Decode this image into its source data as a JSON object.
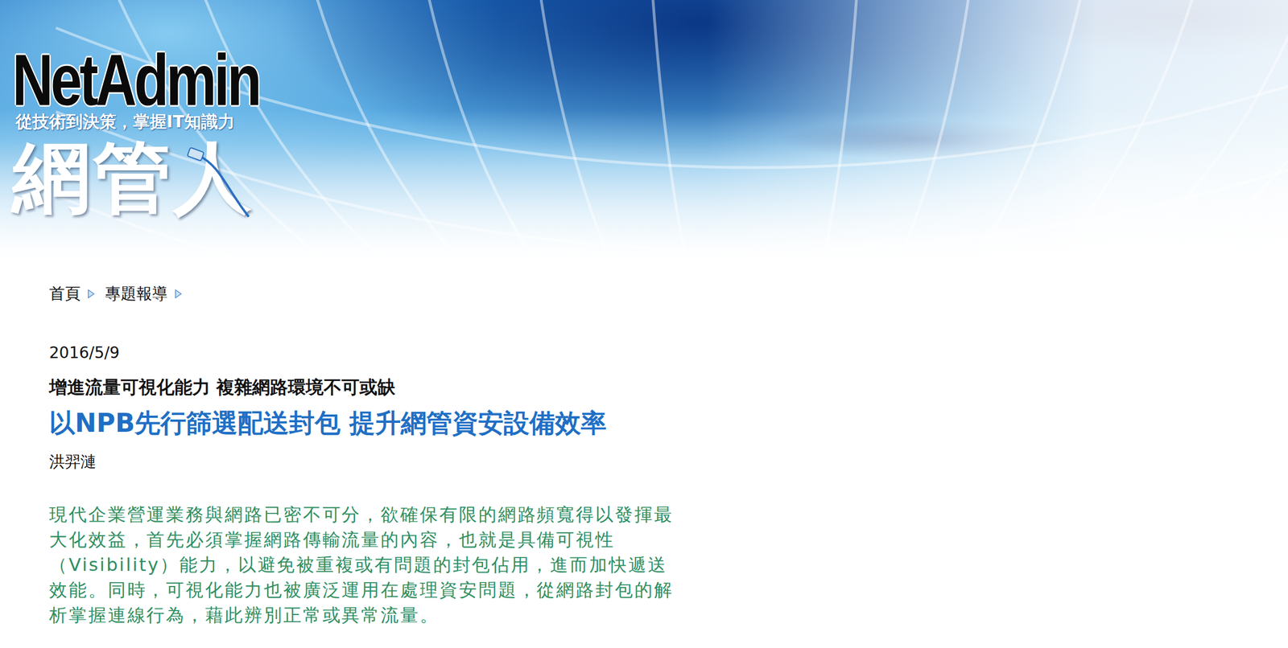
{
  "header": {
    "logo": "NetAdmin",
    "tagline": "從技術到決策，掌握IT知識力",
    "site_name": "網管人"
  },
  "breadcrumb": [
    {
      "label": "首頁"
    },
    {
      "label": "專題報導"
    }
  ],
  "article": {
    "date": "2016/5/9",
    "subtitle": "增進流量可視化能力 複雜網路環境不可或缺",
    "title": "以NPB先行篩選配送封包 提升網管資安設備效率",
    "author": "洪羿漣",
    "lead": "現代企業營運業務與網路已密不可分，欲確保有限的網路頻寬得以發揮最大化效益，首先必須掌握網路傳輸流量的內容，也就是具備可視性（Visibility）能力，以避免被重複或有問題的封包佔用，進而加快遞送效能。同時，可視化能力也被廣泛運用在處理資安問題，從網路封包的解析掌握連線行為，藉此辨別正常或異常流量。"
  }
}
